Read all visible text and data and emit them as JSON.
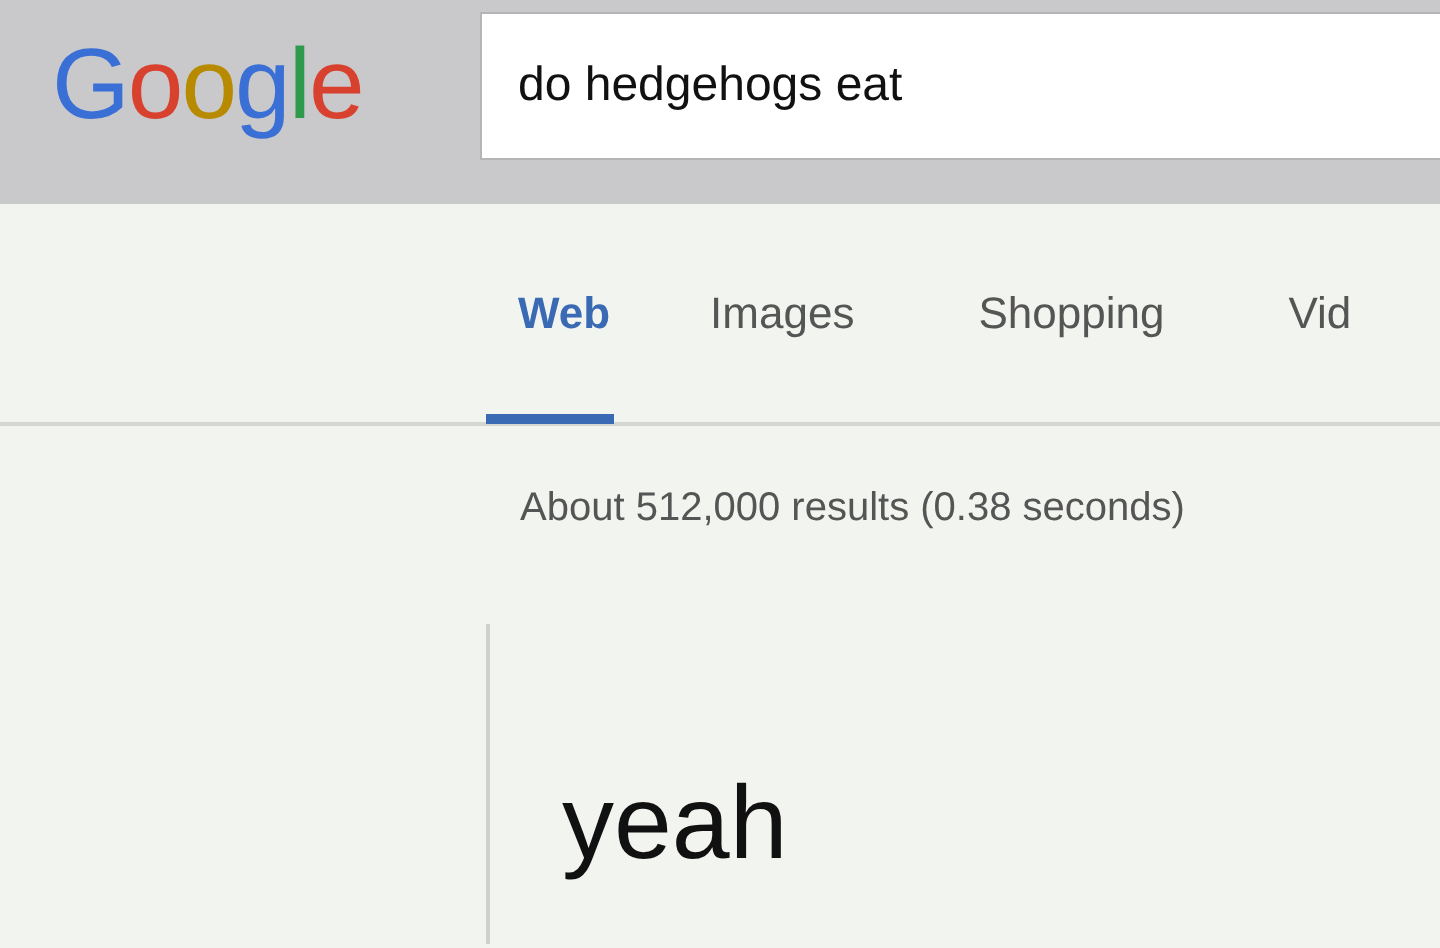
{
  "header": {
    "logo": "Google",
    "search": {
      "value": "do hedgehogs eat"
    }
  },
  "tabs": [
    {
      "label": "Web",
      "selected": true
    },
    {
      "label": "Images",
      "selected": false
    },
    {
      "label": "Shopping",
      "selected": false
    },
    {
      "label": "Vid",
      "selected": false
    }
  ],
  "result_stats": "About 512,000 results (0.38 seconds)",
  "answer": "yeah"
}
